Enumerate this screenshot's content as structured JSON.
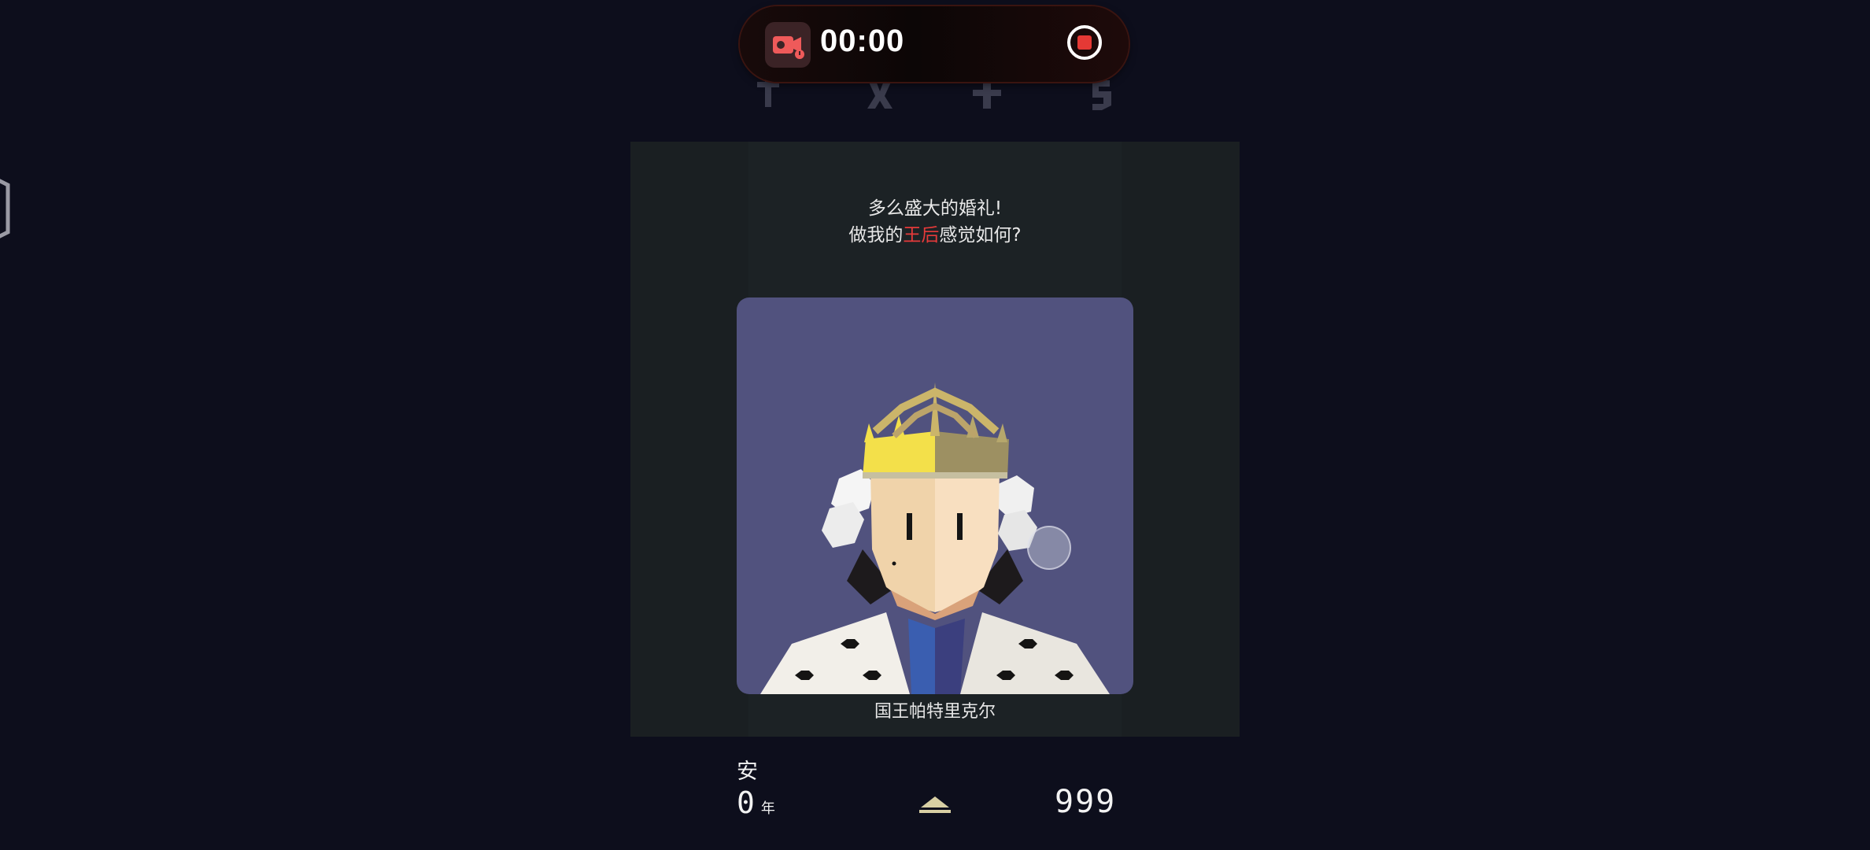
{
  "recorder": {
    "timer": "00:00",
    "icons": [
      "video-camera-icon",
      "stop-record-icon"
    ]
  },
  "top_bar": {
    "icons": [
      "religion-cross-icon",
      "people-icon",
      "army-sword-icon",
      "money-icon"
    ]
  },
  "card": {
    "dialog_line1": "多么盛大的婚礼!",
    "dialog_line2_before": "做我的",
    "dialog_line2_highlight": "王后",
    "dialog_line2_after": "感觉如何?",
    "character_name": "国王帕特里克尔",
    "colors": {
      "highlight": "#e63a3a",
      "portrait_bg": "#51527e",
      "card_bg": "#1a1f22"
    }
  },
  "status": {
    "ruler_name": "安",
    "years_value": "0",
    "years_unit": "年",
    "score": "999"
  }
}
